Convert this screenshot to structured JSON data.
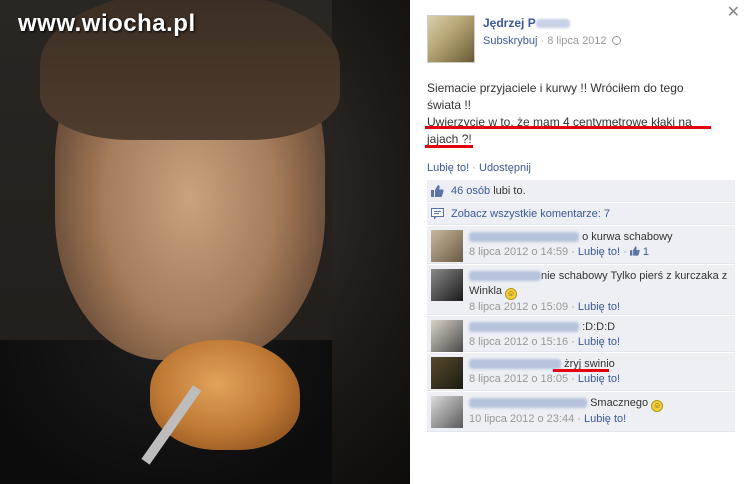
{
  "watermark": "www.wiocha.pl",
  "post": {
    "author": "Jędrzej P",
    "subscribe": "Subskrybuj",
    "date": "8 lipca 2012",
    "text_line1": "Siemacie przyjaciele i kurwy !! Wróciłem do tego",
    "text_line2": "świata !!",
    "text_line3": "Uwierzycie w to, że mam 4 centymetrowe kłaki na",
    "text_line4": "jajach ?!",
    "like_link": "Lubię to!",
    "share_link": "Udostępnij",
    "sep": "·",
    "likes_count": "46 osób",
    "likes_suffix": "lubi to.",
    "view_all": "Zobacz wszystkie komentarze: 7"
  },
  "comments": [
    {
      "text": "o kurwa schabowy",
      "time": "8 lipca 2012 o 14:59",
      "like": "Lubię to!",
      "likes": "1"
    },
    {
      "text": "nie schabowy Tylko pierś z kurczaka z Winkla",
      "time": "8 lipca 2012 o 15:09",
      "like": "Lubię to!"
    },
    {
      "text": ":D:D:D",
      "time": "8 lipca 2012 o 15:16",
      "like": "Lubię to!"
    },
    {
      "text": "żryj swinio",
      "time": "8 lipca 2012 o 18:05",
      "like": "Lubię to!"
    },
    {
      "text": "Smacznego",
      "time": "10 lipca 2012 o 23:44",
      "like": "Lubię to!"
    }
  ],
  "colors": {
    "fb_link": "#3b5998",
    "highlight": "#e3000f",
    "comment_bg": "#edeff4"
  },
  "icons": [
    "close-icon",
    "globe-icon",
    "thumbs-up-icon",
    "comment-icon",
    "smiley-icon"
  ]
}
